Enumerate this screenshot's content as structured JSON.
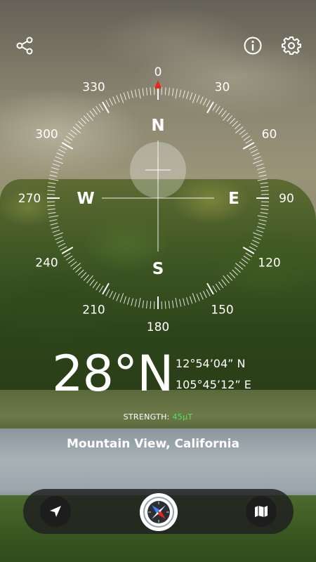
{
  "compass": {
    "degree_labels": [
      "0",
      "30",
      "60",
      "90",
      "120",
      "150",
      "180",
      "210",
      "240",
      "270",
      "300",
      "330"
    ],
    "cardinals": {
      "north": "N",
      "east": "E",
      "south": "S",
      "west": "W"
    }
  },
  "reading": {
    "heading": "28°N",
    "latitude": "12°54’04” N",
    "longitude": "105°45’12” E"
  },
  "strength": {
    "label": "STRENGTH:",
    "value": "45µT"
  },
  "location": "Mountain View, California",
  "icons": {
    "share": "share-icon",
    "info": "info-icon",
    "settings": "gear-icon",
    "navigate": "navigation-arrow-icon",
    "compass": "compass-icon",
    "map": "map-icon"
  },
  "colors": {
    "north_marker": "#e8271c",
    "strength_value": "#58e05a"
  }
}
